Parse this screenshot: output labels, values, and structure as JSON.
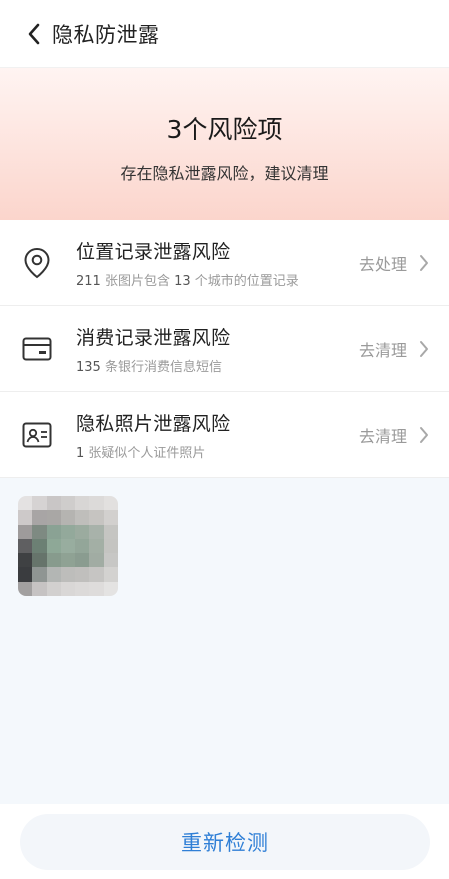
{
  "header": {
    "title": "隐私防泄露",
    "back_icon": "chevron-left-icon"
  },
  "banner": {
    "risk_count": "3个风险项",
    "description": "存在隐私泄露风险，建议清理"
  },
  "items": [
    {
      "icon": "location-pin-icon",
      "title": "位置记录泄露风险",
      "count1": "211",
      "text1": " 张图片包含 ",
      "count2": "13",
      "text2": " 个城市的位置记录",
      "action": "去处理"
    },
    {
      "icon": "card-icon",
      "title": "消费记录泄露风险",
      "count1": "135",
      "text1": " 条银行消费信息短信",
      "action": "去清理"
    },
    {
      "icon": "id-card-icon",
      "title": "隐私照片泄露风险",
      "count1": "1",
      "text1": " 张疑似个人证件照片",
      "action": "去清理"
    }
  ],
  "footer": {
    "rescan_label": "重新检测"
  },
  "colors": {
    "accent": "#2f7fd6",
    "banner_bottom": "#fbd5cc",
    "gallery_bg": "#f4f8fc"
  }
}
